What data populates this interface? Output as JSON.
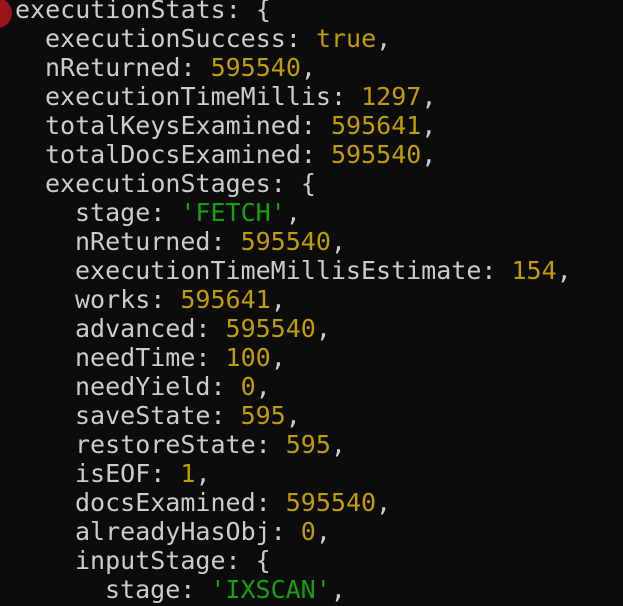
{
  "colors": {
    "background": "#0c0c0c",
    "key": "#cccccc",
    "number": "#c19c00",
    "string": "#13a10e",
    "marker": "#9c1318"
  },
  "lines": [
    {
      "key": "executionStats",
      "value": "{",
      "type": "brace",
      "indent": 0
    },
    {
      "key": "executionSuccess",
      "value": "true",
      "type": "bool",
      "indent": 1
    },
    {
      "key": "nReturned",
      "value": "595540",
      "type": "num",
      "indent": 1
    },
    {
      "key": "executionTimeMillis",
      "value": "1297",
      "type": "num",
      "indent": 1
    },
    {
      "key": "totalKeysExamined",
      "value": "595641",
      "type": "num",
      "indent": 1
    },
    {
      "key": "totalDocsExamined",
      "value": "595540",
      "type": "num",
      "indent": 1
    },
    {
      "key": "executionStages",
      "value": "{",
      "type": "brace",
      "indent": 1
    },
    {
      "key": "stage",
      "value": "'FETCH'",
      "type": "str",
      "indent": 2
    },
    {
      "key": "nReturned",
      "value": "595540",
      "type": "num",
      "indent": 2
    },
    {
      "key": "executionTimeMillisEstimate",
      "value": "154",
      "type": "num",
      "indent": 2
    },
    {
      "key": "works",
      "value": "595641",
      "type": "num",
      "indent": 2
    },
    {
      "key": "advanced",
      "value": "595540",
      "type": "num",
      "indent": 2
    },
    {
      "key": "needTime",
      "value": "100",
      "type": "num",
      "indent": 2
    },
    {
      "key": "needYield",
      "value": "0",
      "type": "num",
      "indent": 2
    },
    {
      "key": "saveState",
      "value": "595",
      "type": "num",
      "indent": 2
    },
    {
      "key": "restoreState",
      "value": "595",
      "type": "num",
      "indent": 2
    },
    {
      "key": "isEOF",
      "value": "1",
      "type": "num",
      "indent": 2
    },
    {
      "key": "docsExamined",
      "value": "595540",
      "type": "num",
      "indent": 2
    },
    {
      "key": "alreadyHasObj",
      "value": "0",
      "type": "num",
      "indent": 2
    },
    {
      "key": "inputStage",
      "value": "{",
      "type": "brace",
      "indent": 2
    },
    {
      "key": "stage",
      "value": "'IXSCAN'",
      "type": "str",
      "indent": 3
    }
  ]
}
